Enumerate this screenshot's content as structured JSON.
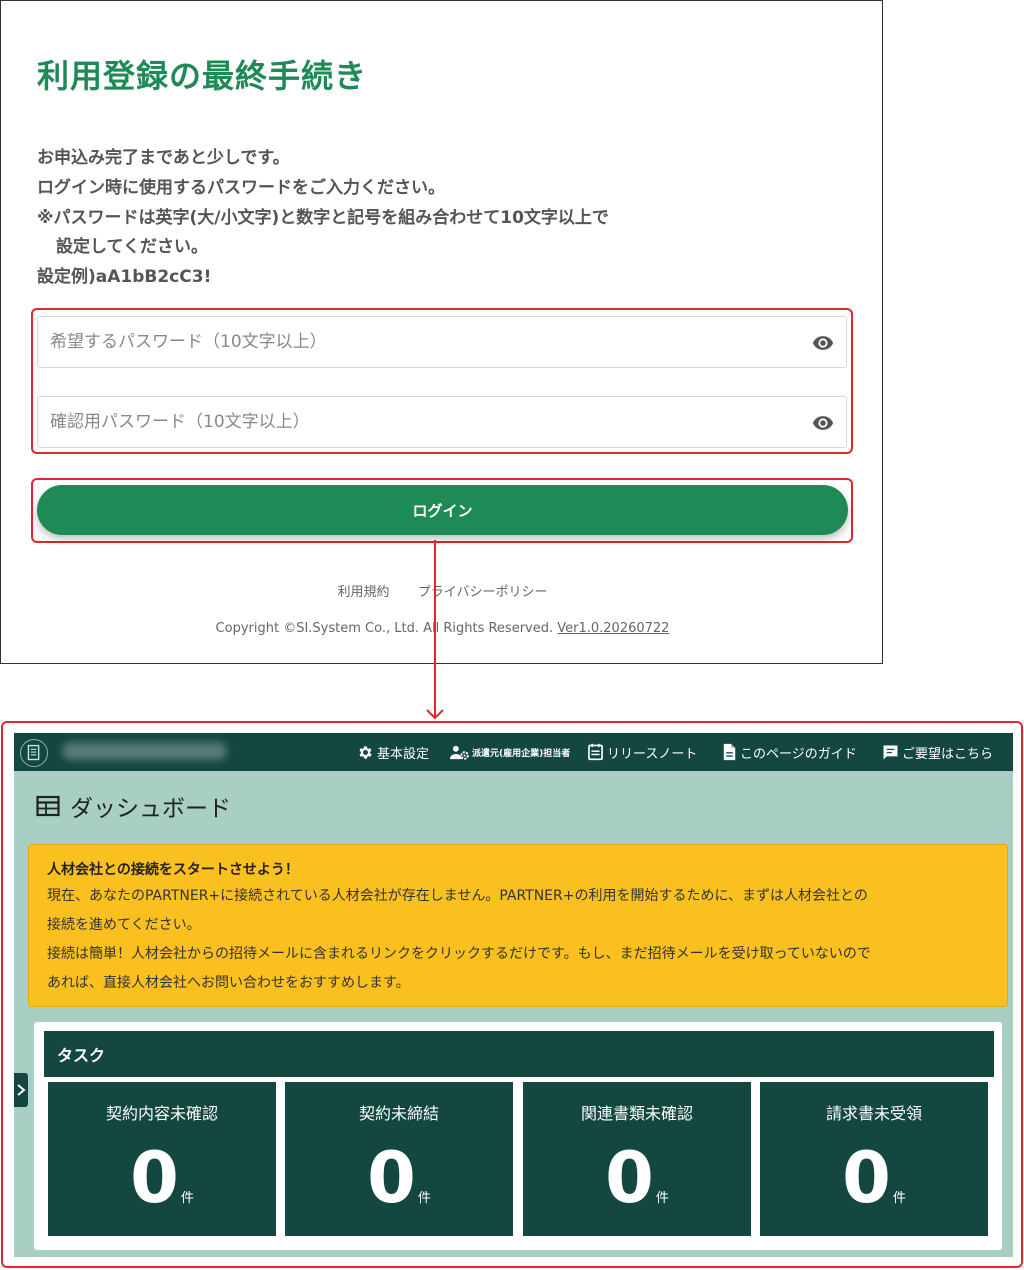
{
  "registration": {
    "title": "利用登録の最終手続き",
    "description": [
      "お申込み完了まであと少しです。",
      "ログイン時に使用するパスワードをご入力ください。",
      "※パスワードは英字(大/小文字)と数字と記号を組み合わせて10文字以上で",
      "設定してください。",
      "設定例)aA1bB2cC3!"
    ],
    "password_placeholder": "希望するパスワード（10文字以上）",
    "confirm_placeholder": "確認用パスワード（10文字以上）",
    "login_label": "ログイン",
    "footer_links": [
      "利用規約",
      "プライバシーポリシー"
    ],
    "copyright": "Copyright ©SI.System Co., Ltd. All Rights Reserved.",
    "version": "Ver1.0.20260722",
    "highlight_color": "#e0262e",
    "accent_color": "#1e8a55"
  },
  "dashboard": {
    "header": {
      "items": [
        {
          "icon": "gear-icon",
          "label": "基本設定"
        },
        {
          "icon": "user-gear-icon",
          "label": "派遣元(雇用企業)担当者"
        },
        {
          "icon": "calendar-list-icon",
          "label": "リリースノート"
        },
        {
          "icon": "document-icon",
          "label": "このページのガイド"
        },
        {
          "icon": "message-icon",
          "label": "ご要望はこちら"
        }
      ]
    },
    "title": "ダッシュボード",
    "notice": {
      "title": "人材会社との接続をスタートさせよう！",
      "lines": [
        "現在、あなたのPARTNER+に接続されている人材会社が存在しません。PARTNER+の利用を開始するために、まずは人材会社との",
        "接続を進めてください。",
        "接続は簡単！人材会社からの招待メールに含まれるリンクをクリックするだけです。もし、まだ招待メールを受け取っていないので",
        "あれば、直接人材会社へお問い合わせをおすすめします。"
      ]
    },
    "tasks": {
      "header": "タスク",
      "unit": "件",
      "cards": [
        {
          "label": "契約内容未確認",
          "count": "0"
        },
        {
          "label": "契約未締結",
          "count": "0"
        },
        {
          "label": "関連書類未確認",
          "count": "0"
        },
        {
          "label": "請求書未受領",
          "count": "0"
        }
      ]
    },
    "colors": {
      "header": "#134740",
      "background": "#a9cfc4",
      "notice": "#f9c01f"
    }
  }
}
